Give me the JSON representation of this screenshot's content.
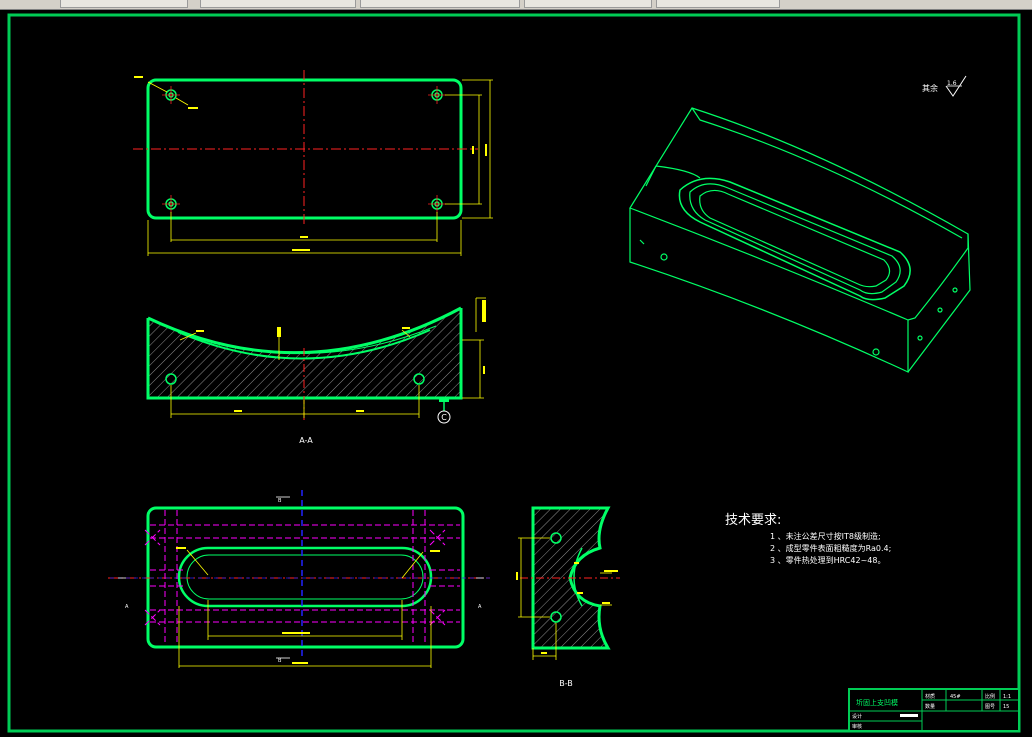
{
  "tabs": [
    "",
    "",
    "",
    "",
    ""
  ],
  "section_aa": "A-A",
  "section_bb": "B-B",
  "roughness_label": "其余",
  "roughness_value": "1.6",
  "datum_c": "C",
  "cut_marks": {
    "a": "A",
    "b": "B"
  },
  "tech_requirements": {
    "title": "技术要求:",
    "items": [
      "1 、未注公差尺寸按IT8级制造;",
      "2 、成型零件表面粗糙度为Ra0.4;",
      "3 、零件热处理到HRC42~48。"
    ]
  },
  "title_block": {
    "part_name": "圻固上支凹模",
    "material_label": "材质",
    "material_value": "45#",
    "scale_label": "比例",
    "scale_value": "1:1",
    "qty_label": "数量",
    "drawing_no_label": "图号",
    "drawing_no_value": "15",
    "designer_label": "设计",
    "checker_label": "审核"
  },
  "colors": {
    "outline": "#00ff66",
    "frame": "#00cc55",
    "centerline": "#ff2222",
    "dimension": "#ffff00",
    "hidden": "#ff00ff",
    "axis": "#2222ff",
    "text": "#ffffff"
  }
}
